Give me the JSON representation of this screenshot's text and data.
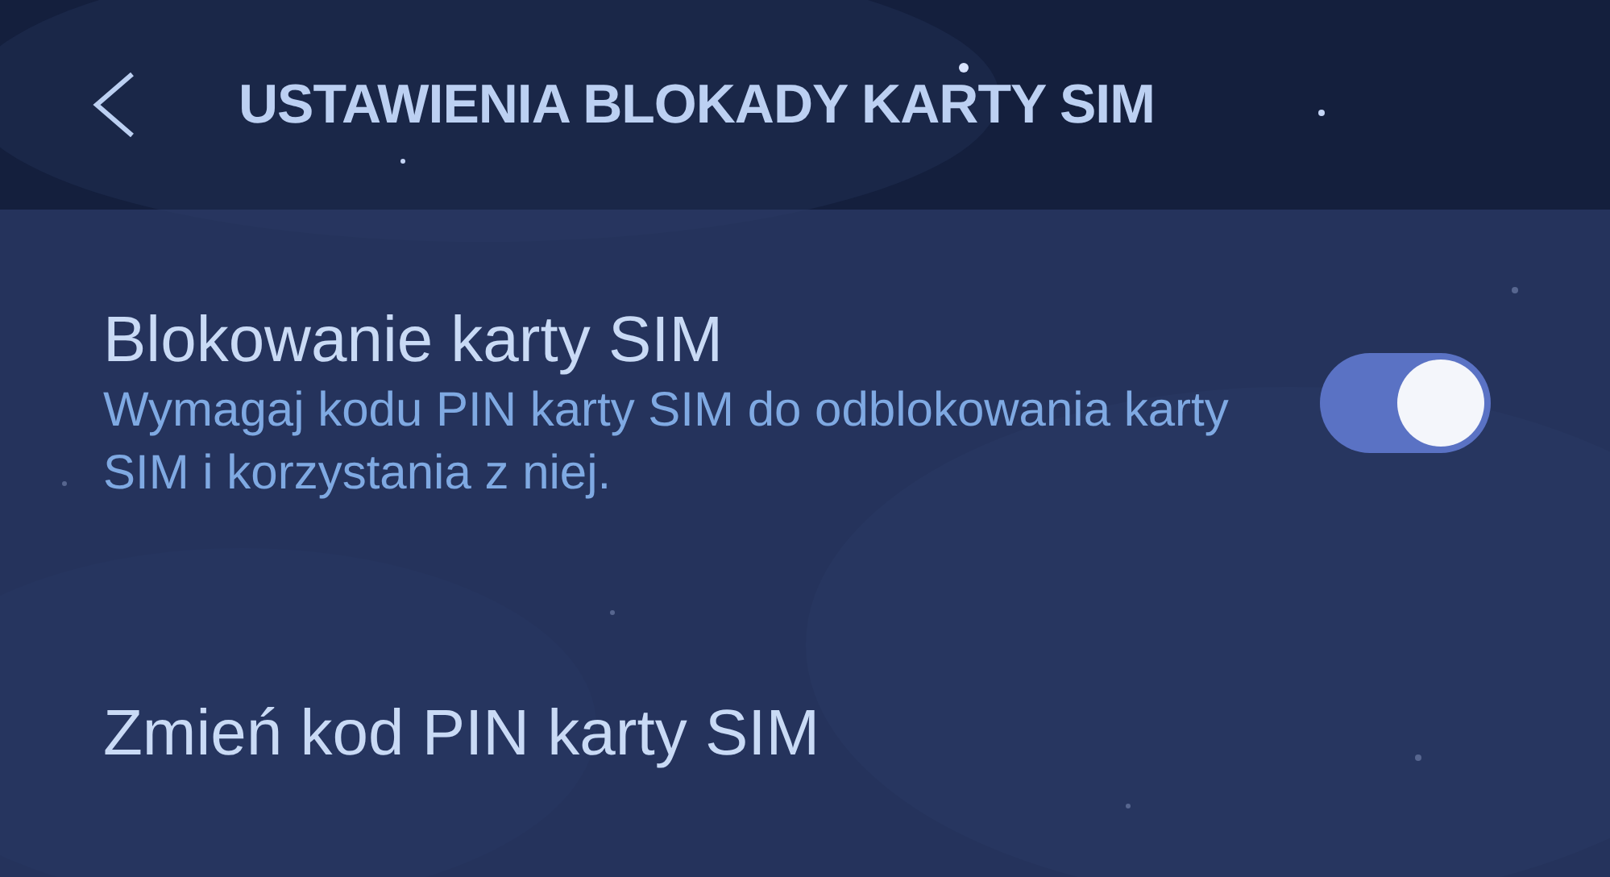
{
  "header": {
    "title": "USTAWIENIA BLOKADY KARTY SIM"
  },
  "items": [
    {
      "kind": "toggle",
      "title": "Blokowanie karty SIM",
      "summary": "Wymagaj kodu PIN karty SIM do odblokowania karty SIM i korzystania z niej.",
      "on": true
    },
    {
      "kind": "link",
      "title": "Zmień kod PIN karty SIM"
    }
  ]
}
